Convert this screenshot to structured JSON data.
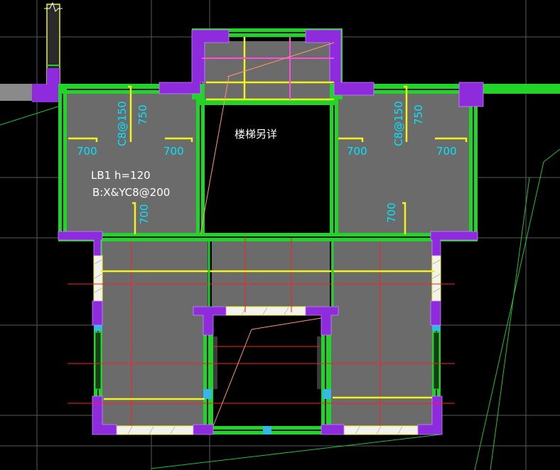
{
  "drawing": {
    "background": "#000000",
    "colors": {
      "slab": "#6b6b6b",
      "wall_green": "#22d32a",
      "wall_purple": "#8e2bdc",
      "rebar_yellow": "#f2f21c",
      "dim_cyan": "#00e6ff",
      "axis_red": "#ff1e1e",
      "magenta": "#ff4ddc",
      "text_white": "#ffffff",
      "grid_gray": "#6a6a6a",
      "guide_green": "#1fbf3a",
      "leader_orange": "#ff9a6a"
    },
    "labels": {
      "stair_note": "楼梯另详",
      "slab_name": "LB1 h=120",
      "slab_rebar": "B:X&YC8@200",
      "left_rebar": "C8@150",
      "left_rebar_len": "750",
      "left_dim_a": "700",
      "left_dim_b": "700",
      "left_dim_c": "700",
      "right_rebar": "C8@150",
      "right_rebar_len": "750",
      "right_dim_a": "700",
      "right_dim_b": "700",
      "right_dim_c": "700"
    }
  }
}
